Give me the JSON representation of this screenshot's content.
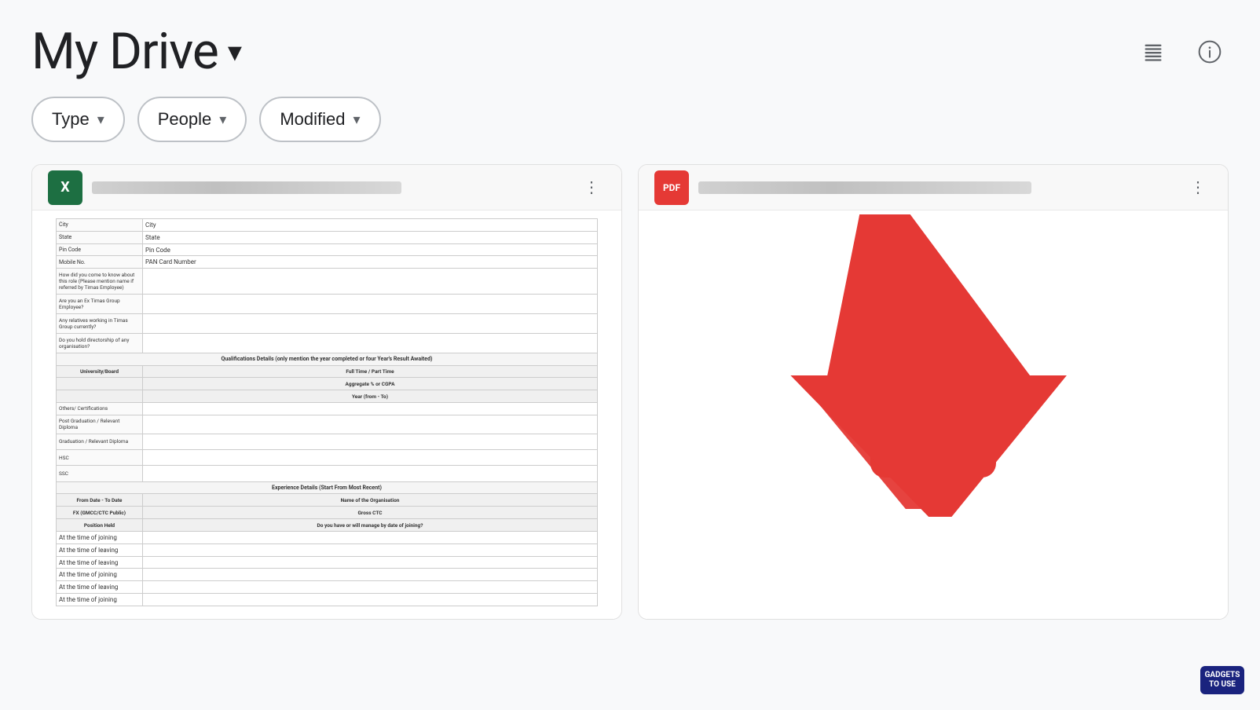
{
  "header": {
    "title": "My Drive",
    "title_dropdown_symbol": "▾",
    "icons": [
      {
        "name": "list-view-icon",
        "symbol": "☰"
      },
      {
        "name": "info-icon",
        "symbol": "ⓘ"
      }
    ]
  },
  "filters": [
    {
      "name": "type-filter",
      "label": "Type",
      "chevron": "▾"
    },
    {
      "name": "people-filter",
      "label": "People",
      "chevron": "▾"
    },
    {
      "name": "modified-filter",
      "label": "Modified",
      "chevron": "▾"
    }
  ],
  "files": [
    {
      "id": "excel-file",
      "icon_type": "excel",
      "icon_label": "X",
      "type": "excel"
    },
    {
      "id": "pdf-file",
      "icon_type": "pdf",
      "icon_label": "PDF",
      "type": "pdf"
    }
  ],
  "excel_rows": [
    {
      "label": "City",
      "value": "City"
    },
    {
      "label": "State",
      "value": "State"
    },
    {
      "label": "Pin Code",
      "value": "Pin Code"
    },
    {
      "label": "Mobile No.",
      "value": "PAN Card Number"
    },
    {
      "label": "How did you come to know about this role (Please mention name if referred by Timas Employee)",
      "value": ""
    },
    {
      "label": "Are you an Ex Timas Group Employee?",
      "value": ""
    },
    {
      "label": "Any relatives working in Timas Group currently?",
      "value": ""
    },
    {
      "label": "Do you hold directorship of any organisation?",
      "value": ""
    }
  ],
  "watermark": {
    "line1": "GADGETS",
    "line2": "TO USE"
  },
  "arrow": {
    "description": "Red arrow pointing down-right toward PDF icon"
  }
}
